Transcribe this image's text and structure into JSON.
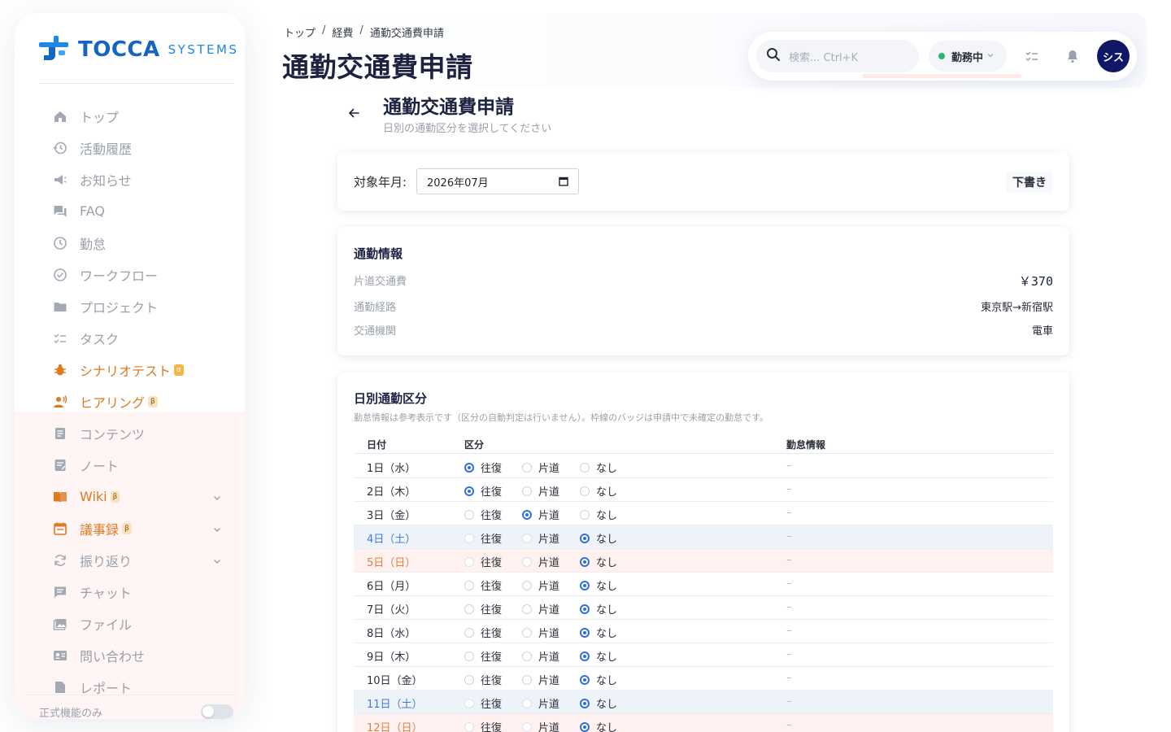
{
  "brand": {
    "name": "TOCCA",
    "suffix": "SYSTEMS"
  },
  "nav": [
    {
      "label": "トップ",
      "icon": "home-icon",
      "orange": false
    },
    {
      "label": "活動履歴",
      "icon": "history-icon",
      "orange": false
    },
    {
      "label": "お知らせ",
      "icon": "megaphone-icon",
      "orange": false
    },
    {
      "label": "FAQ",
      "icon": "faq-icon",
      "orange": false
    },
    {
      "label": "勤怠",
      "icon": "clock-icon",
      "orange": false
    },
    {
      "label": "ワークフロー",
      "icon": "check-circle-icon",
      "orange": false
    },
    {
      "label": "プロジェクト",
      "icon": "folder-icon",
      "orange": false
    },
    {
      "label": "タスク",
      "icon": "checklist-icon",
      "orange": false
    },
    {
      "label": "シナリオテスト",
      "icon": "bug-icon",
      "orange": true,
      "badge": "α"
    },
    {
      "label": "ヒアリング",
      "icon": "person-voice-icon",
      "orange": true,
      "badge": "β"
    },
    {
      "label": "コンテンツ",
      "icon": "document-icon",
      "orange": false
    },
    {
      "label": "ノート",
      "icon": "note-icon",
      "orange": false
    },
    {
      "label": "Wiki",
      "icon": "book-icon",
      "orange": true,
      "badge": "β",
      "expand": true
    },
    {
      "label": "議事録",
      "icon": "calendar-icon",
      "orange": true,
      "badge": "β",
      "expand": true
    },
    {
      "label": "振り返り",
      "icon": "refresh-icon",
      "orange": false,
      "expand": true
    },
    {
      "label": "チャット",
      "icon": "chat-icon",
      "orange": false
    },
    {
      "label": "ファイル",
      "icon": "image-icon",
      "orange": false
    },
    {
      "label": "問い合わせ",
      "icon": "contact-card-icon",
      "orange": false
    },
    {
      "label": "レポート",
      "icon": "report-icon",
      "orange": false
    }
  ],
  "sidebar_footer": {
    "label": "正式機能のみ",
    "toggle_on": false
  },
  "breadcrumb": [
    "トップ",
    "経費",
    "通勤交通費申請"
  ],
  "page_title": "通勤交通費申請",
  "topbar": {
    "search_placeholder": "検索... Ctrl+K",
    "status_label": "勤務中",
    "avatar_text": "シス"
  },
  "subheader": {
    "title": "通勤交通費申請",
    "description": "日別の通勤区分を選択してください"
  },
  "month_card": {
    "label": "対象年月:",
    "value": "2026年07月",
    "draft_label": "下書き"
  },
  "commute_info": {
    "title": "通勤情報",
    "rows": [
      {
        "key": "片道交通費",
        "value": "￥370",
        "mono": true
      },
      {
        "key": "通勤経路",
        "value": "東京駅→新宿駅",
        "mono": false
      },
      {
        "key": "交通機関",
        "value": "電車",
        "mono": false
      }
    ]
  },
  "daily": {
    "title": "日別通勤区分",
    "note": "勤怠情報は参考表示です（区分の自動判定は行いません）。枠線のバッジは申請中で未確定の勤怠です。",
    "headers": {
      "date": "日付",
      "category": "区分",
      "attendance": "勤怠情報"
    },
    "options": [
      "往復",
      "片道",
      "なし"
    ],
    "rows": [
      {
        "date": "1日（水）",
        "day": "weekday",
        "selected": 0,
        "attendance": "–"
      },
      {
        "date": "2日（木）",
        "day": "weekday",
        "selected": 0,
        "attendance": "–"
      },
      {
        "date": "3日（金）",
        "day": "weekday",
        "selected": 1,
        "attendance": "–"
      },
      {
        "date": "4日（土）",
        "day": "sat",
        "selected": 2,
        "attendance": "–"
      },
      {
        "date": "5日（日）",
        "day": "sun",
        "selected": 2,
        "attendance": "–"
      },
      {
        "date": "6日（月）",
        "day": "weekday",
        "selected": 2,
        "attendance": "–"
      },
      {
        "date": "7日（火）",
        "day": "weekday",
        "selected": 2,
        "attendance": "–"
      },
      {
        "date": "8日（水）",
        "day": "weekday",
        "selected": 2,
        "attendance": "–"
      },
      {
        "date": "9日（木）",
        "day": "weekday",
        "selected": 2,
        "attendance": "–"
      },
      {
        "date": "10日（金）",
        "day": "weekday",
        "selected": 2,
        "attendance": "–"
      },
      {
        "date": "11日（土）",
        "day": "sat",
        "selected": 2,
        "attendance": "–"
      },
      {
        "date": "12日（日）",
        "day": "sun",
        "selected": 2,
        "attendance": "–"
      }
    ]
  },
  "colors": {
    "accent": "#2f6fe0",
    "brand": "#1565c0",
    "orange": "#e07a1f",
    "status_green": "#2bb673",
    "avatar_bg": "#101766"
  }
}
